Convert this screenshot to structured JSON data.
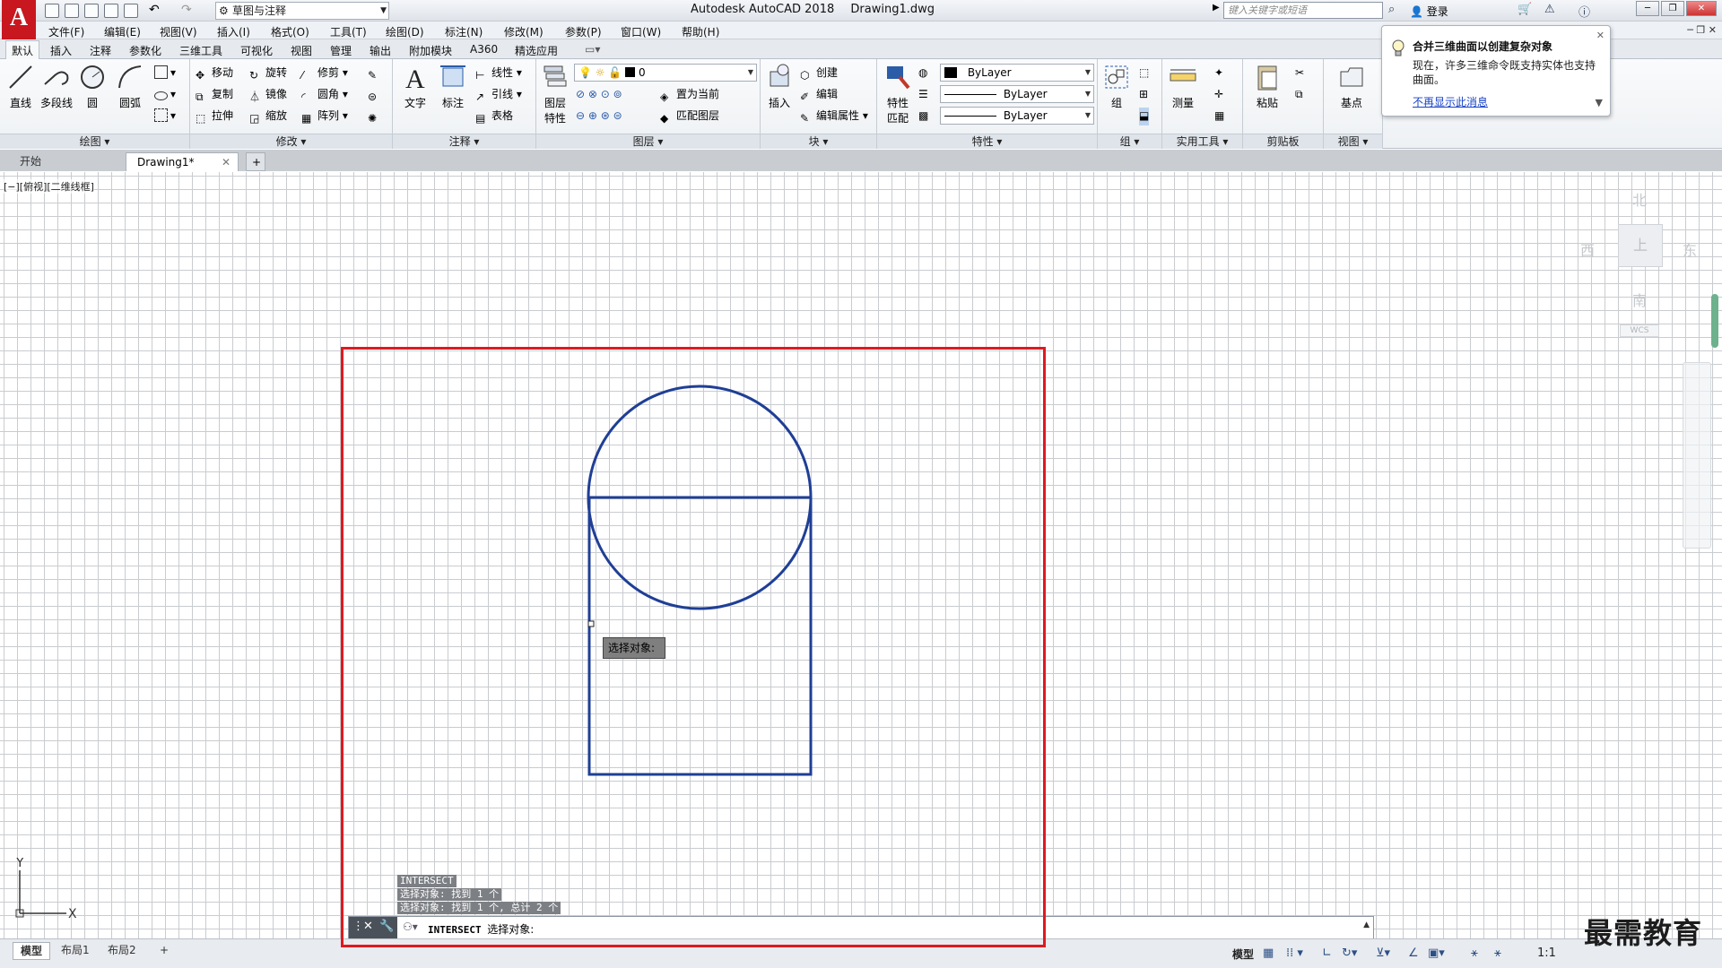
{
  "app": {
    "logo_letter": "A",
    "workspace": "草图与注释",
    "title": "Autodesk AutoCAD 2018",
    "document": "Drawing1.dwg",
    "search_placeholder": "键入关键字或短语",
    "login": "登录"
  },
  "menu": [
    "文件(F)",
    "编辑(E)",
    "视图(V)",
    "插入(I)",
    "格式(O)",
    "工具(T)",
    "绘图(D)",
    "标注(N)",
    "修改(M)",
    "参数(P)",
    "窗口(W)",
    "帮助(H)"
  ],
  "ribbon_tabs": [
    "默认",
    "插入",
    "注释",
    "参数化",
    "三维工具",
    "可视化",
    "视图",
    "管理",
    "输出",
    "附加模块",
    "A360",
    "精选应用"
  ],
  "panels": {
    "draw": {
      "title": "绘图",
      "line": "直线",
      "polyline": "多段线",
      "circle": "圆",
      "arc": "圆弧"
    },
    "modify": {
      "title": "修改",
      "move": "移动",
      "rotate": "旋转",
      "trim": "修剪",
      "copy": "复制",
      "mirror": "镜像",
      "fillet": "圆角",
      "stretch": "拉伸",
      "scale": "缩放",
      "array": "阵列"
    },
    "annotation": {
      "title": "注释",
      "text": "文字",
      "dimension": "标注",
      "linear": "线性",
      "leader": "引线",
      "table": "表格"
    },
    "layers": {
      "title": "图层",
      "layer_props_1": "图层",
      "layer_props_2": "特性",
      "current_layer": "0",
      "make_current": "置为当前",
      "match_layer": "匹配图层"
    },
    "block": {
      "title": "块",
      "insert": "插入",
      "create": "创建",
      "edit": "编辑",
      "edit_attributes": "编辑属性"
    },
    "properties": {
      "title": "特性",
      "match_1": "特性",
      "match_2": "匹配",
      "color": "ByLayer",
      "linetype": "ByLayer",
      "lineweight": "ByLayer"
    },
    "groups": {
      "title": "组",
      "group": "组"
    },
    "utilities": {
      "title": "实用工具",
      "measure": "测量"
    },
    "clipboard": {
      "title": "剪贴板",
      "paste": "粘贴"
    },
    "view": {
      "title": "视图",
      "base": "基点"
    }
  },
  "balloon": {
    "title": "合并三维曲面以创建复杂对象",
    "body": "现在，许多三维命令既支持实体也支持曲面。",
    "link": "不再显示此消息"
  },
  "file_tabs": {
    "start": "开始",
    "drawing": "Drawing1*"
  },
  "viewport_label": "[−][俯视][二维线框]",
  "viewcube": {
    "north": "北",
    "south": "南",
    "east": "东",
    "west": "西",
    "face": "上",
    "wcs": "WCS"
  },
  "ucs": {
    "x": "X",
    "y": "Y"
  },
  "select_tooltip": "选择对象:",
  "command_history": [
    "INTERSECT",
    "选择对象: 找到 1 个",
    "选择对象: 找到 1 个, 总计 2 个"
  ],
  "command_line": {
    "command": "INTERSECT",
    "prompt": "选择对象:"
  },
  "layout_tabs": [
    "模型",
    "布局1",
    "布局2"
  ],
  "status": {
    "model": "模型",
    "scale": "1:1"
  },
  "watermark": "最需教育",
  "colors": {
    "highlight_box": "#e0191f",
    "geometry": "#1f3f96",
    "logo": "#c8171f"
  }
}
